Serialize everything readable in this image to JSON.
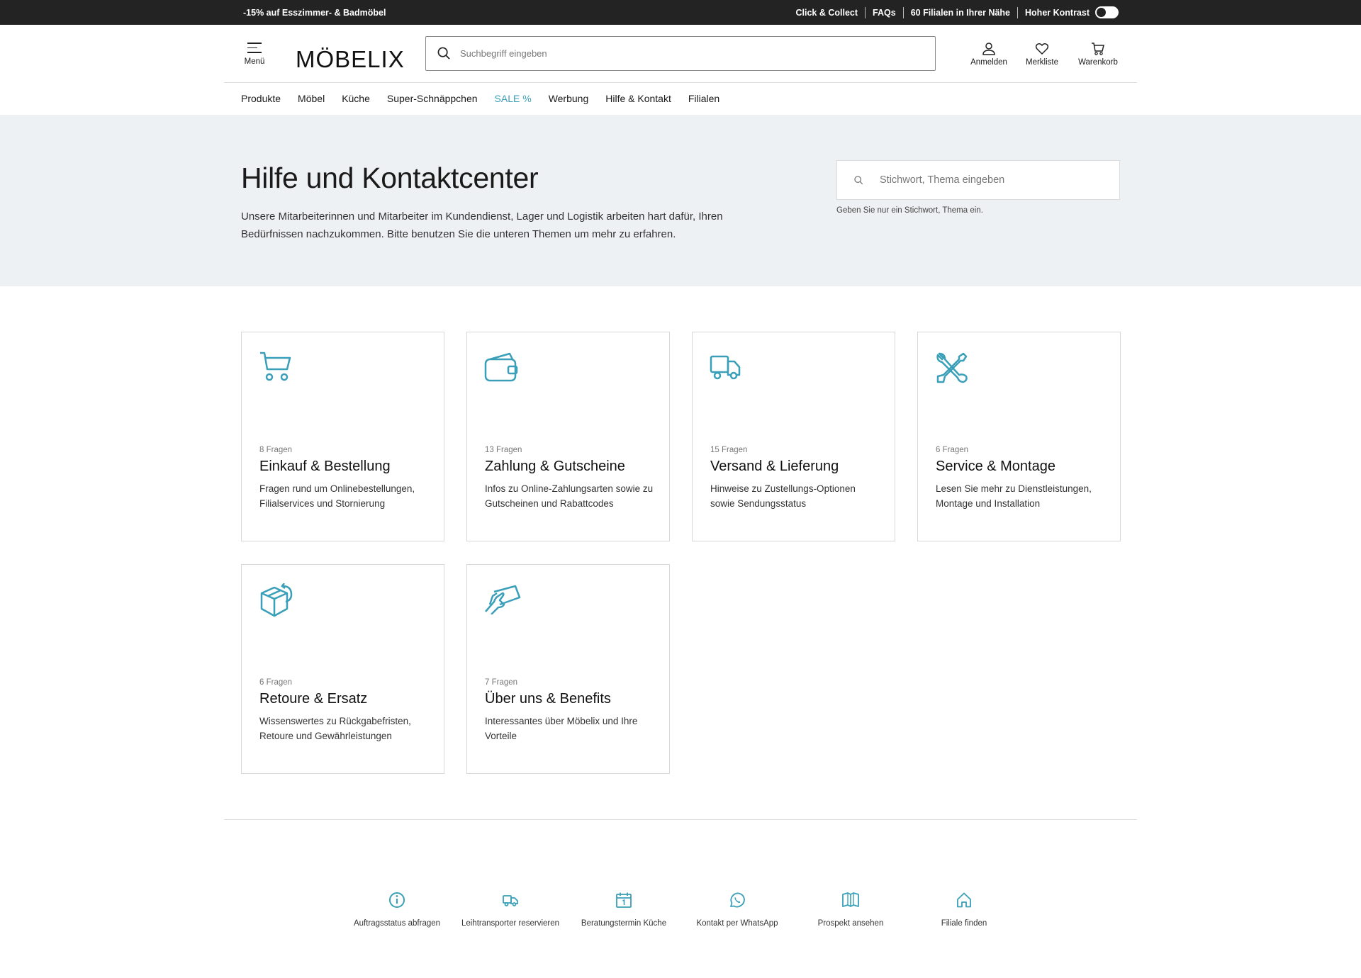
{
  "topbar": {
    "promo": "-15% auf Esszimmer- & Badmöbel",
    "links": [
      "Click & Collect",
      "FAQs",
      "60 Filialen in Ihrer Nähe",
      "Hoher Kontrast"
    ]
  },
  "header": {
    "menu_label": "Menü",
    "logo": "MÖBELIX",
    "search_placeholder": "Suchbegriff eingeben",
    "login": "Anmelden",
    "wishlist": "Merkliste",
    "cart": "Warenkorb"
  },
  "nav": [
    "Produkte",
    "Möbel",
    "Küche",
    "Super-Schnäppchen",
    "SALE %",
    "Werbung",
    "Hilfe & Kontakt",
    "Filialen"
  ],
  "hero": {
    "title": "Hilfe und Kontaktcenter",
    "text": "Unsere Mitarbeiterinnen und Mitarbeiter im Kundendienst, Lager und Logistik arbeiten hart dafür, Ihren Bedürfnissen nachzukommen. Bitte benutzen Sie die unteren Themen um mehr zu erfahren.",
    "search_placeholder": "Stichwort, Thema eingeben",
    "search_hint": "Geben Sie nur ein Stichwort, Thema ein."
  },
  "cards": [
    {
      "icon": "cart-icon",
      "count": "8 Fragen",
      "title": "Einkauf & Bestellung",
      "desc": "Fragen rund um Onlinebestellungen, Filialservices und Stornierung"
    },
    {
      "icon": "wallet-icon",
      "count": "13 Fragen",
      "title": "Zahlung & Gutscheine",
      "desc": "Infos zu Online-Zahlungsarten sowie zu Gutscheinen und Rabattcodes"
    },
    {
      "icon": "truck-icon",
      "count": "15 Fragen",
      "title": "Versand & Lieferung",
      "desc": "Hinweise zu Zustellungs-Optionen sowie Sendungsstatus"
    },
    {
      "icon": "tools-icon",
      "count": "6 Fragen",
      "title": "Service & Montage",
      "desc": "Lesen Sie mehr zu Dienstleistungen, Montage und Installation"
    },
    {
      "icon": "box-return-icon",
      "count": "6 Fragen",
      "title": "Retoure & Ersatz",
      "desc": "Wissenswertes zu Rückgabefristen, Retoure und Gewährleistungen"
    },
    {
      "icon": "card-hand-icon",
      "count": "7 Fragen",
      "title": "Über uns & Benefits",
      "desc": "Interessantes über Möbelix und Ihre Vorteile"
    }
  ],
  "quicklinks": [
    {
      "icon": "info-icon",
      "label": "Auftragsstatus abfragen"
    },
    {
      "icon": "truck-icon",
      "label": "Leihtransporter reservieren"
    },
    {
      "icon": "calendar-icon",
      "label": "Beratungstermin Küche"
    },
    {
      "icon": "whatsapp-icon",
      "label": "Kontakt per WhatsApp"
    },
    {
      "icon": "book-icon",
      "label": "Prospekt ansehen"
    },
    {
      "icon": "house-icon",
      "label": "Filiale finden"
    }
  ],
  "colors": {
    "accent": "#3a9fb8",
    "topbar": "#232323",
    "hero_bg": "#eef1f3"
  }
}
